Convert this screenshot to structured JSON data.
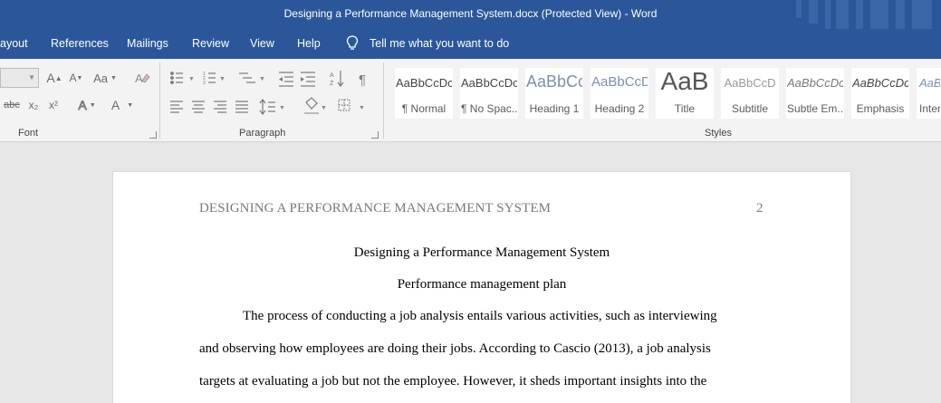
{
  "window": {
    "title": "Designing a Performance Management System.docx (Protected View)  -  Word"
  },
  "tabs": [
    "ayout",
    "References",
    "Mailings",
    "Review",
    "View",
    "Help"
  ],
  "tell_me": "Tell me what you want to do",
  "ribbon": {
    "groups": {
      "font": "Font",
      "paragraph": "Paragraph",
      "styles": "Styles"
    },
    "font_buttons": {
      "grow": "A",
      "shrink": "A",
      "case": "Aa",
      "strike": "abc",
      "subscript": "x₂",
      "superscript": "x²",
      "effects": "A",
      "color": "A"
    },
    "styles": [
      {
        "preview": "AaBbCcDc",
        "name": "¶ Normal"
      },
      {
        "preview": "AaBbCcDc",
        "name": "¶ No Spac..."
      },
      {
        "preview": "AaBbCc",
        "name": "Heading 1"
      },
      {
        "preview": "AaBbCcD",
        "name": "Heading 2"
      },
      {
        "preview": "AaB",
        "name": "Title"
      },
      {
        "preview": "AaBbCcD",
        "name": "Subtitle"
      },
      {
        "preview": "AaBbCcDc",
        "name": "Subtle Em..."
      },
      {
        "preview": "AaBbCcDc",
        "name": "Emphasis"
      },
      {
        "preview": "AaBb",
        "name": "Inter"
      }
    ]
  },
  "document": {
    "header": "DESIGNING A PERFORMANCE MANAGEMENT SYSTEM",
    "page_number": "2",
    "title": "Designing a Performance Management System",
    "subtitle": "Performance management plan",
    "lines": [
      "The process of conducting a job analysis entails various activities, such as interviewing",
      "and observing how employees are doing their jobs. According to Cascio (2013), a job analysis",
      "targets at evaluating a job but not the employee. However, it sheds important insights into the"
    ]
  }
}
